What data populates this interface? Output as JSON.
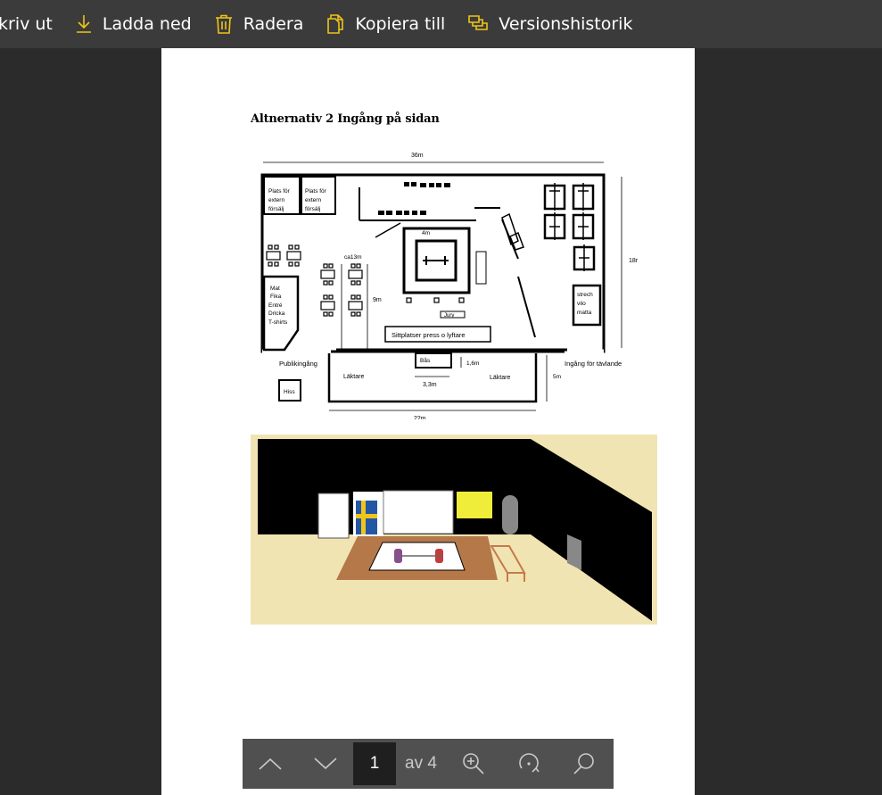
{
  "toolbar": {
    "print_label": "kriv ut",
    "download_label": "Ladda ned",
    "delete_label": "Radera",
    "copy_label": "Kopiera till",
    "history_label": "Versionshistorik",
    "icon_color": "#f0c419"
  },
  "document": {
    "heading": "Altnernativ 2 Ingång på sidan",
    "plan": {
      "dim_top": "36m",
      "dim_right": "18r",
      "dim_bottom": "22m",
      "vendor_1": [
        "Plats för",
        "extern",
        "försälj"
      ],
      "vendor_2": [
        "Plats för",
        "extern",
        "försälj"
      ],
      "food_stand": [
        "Mat",
        "Fika",
        "Entré",
        "Dricka",
        "T-shirts"
      ],
      "ca13m": "ca13m",
      "9m": "9m",
      "4m": "4m",
      "jury": "Jury",
      "seats_label": "Sittplatser press o lyftare",
      "strech": [
        "strech",
        "vilo",
        "matta"
      ],
      "public_entrance": "Publikingång",
      "lift": "Hiss",
      "bas": "Bås",
      "stand_left": "Läktare",
      "stand_right": "Läktare",
      "dim_16": "1,6m",
      "dim_33": "3,3m",
      "dim_5": "5m",
      "athlete_entrance": "Ingång för tävlande"
    }
  },
  "nav": {
    "page_value": "1",
    "page_of": "av 4"
  }
}
